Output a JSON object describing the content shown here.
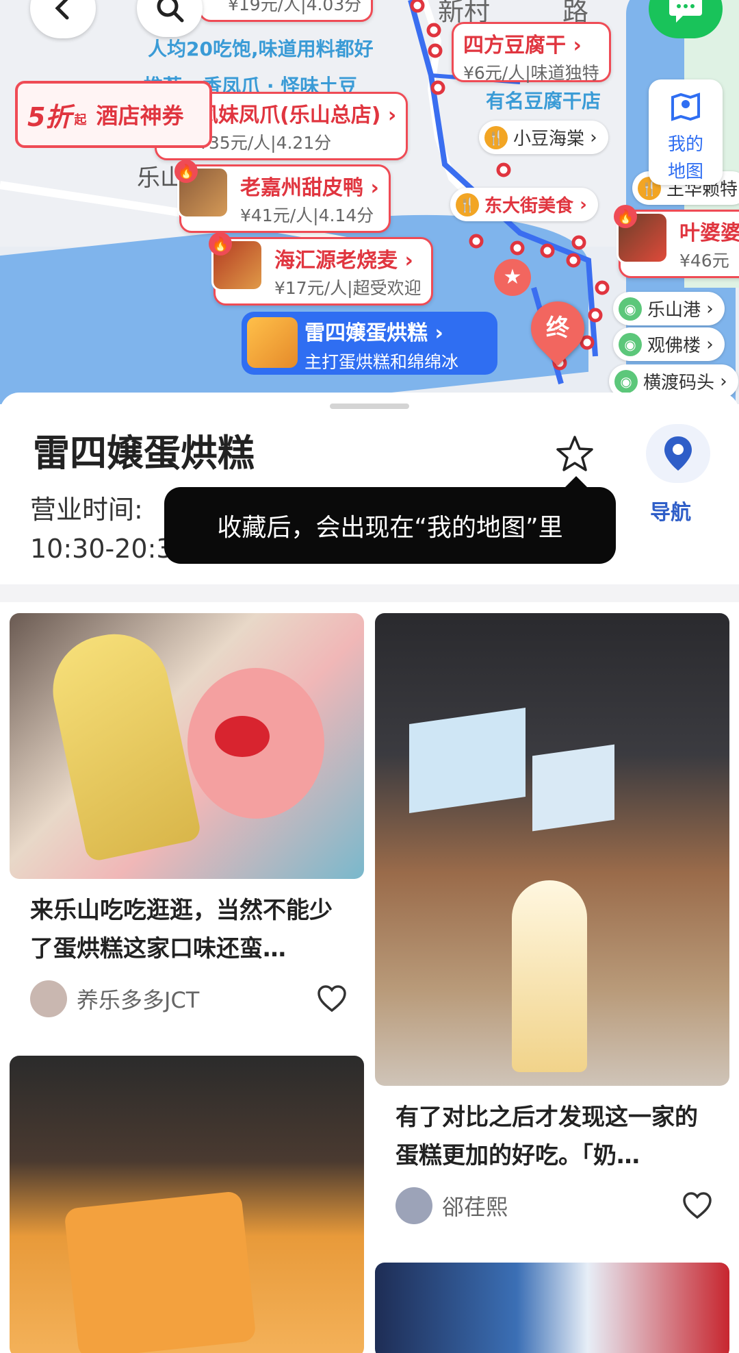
{
  "map": {
    "coupon": {
      "discount": "5折",
      "qi": "起",
      "label": "酒店神券"
    },
    "labels": {
      "area_text": "人均20吃饱,味道用料都好",
      "tags_line": "推荐 · 香凤爪 · 怪味土豆",
      "road1": "新村",
      "road2": "路",
      "known_tofu": "有名豆腐干店",
      "leshan_text": "乐山"
    },
    "pins": [
      {
        "title": "",
        "sub": "¥19元/人|4.03分"
      },
      {
        "title": "四方豆腐干",
        "sub": "¥6元/人|味道独特"
      },
      {
        "title": "凤妹凤爪(乐山总店)",
        "sub": "¥35元/人|4.21分"
      },
      {
        "title": "老嘉州甜皮鸭",
        "sub": "¥41元/人|4.14分"
      },
      {
        "title": "海汇源老烧麦",
        "sub": "¥17元/人|超受欢迎"
      },
      {
        "title": "叶婆婆",
        "sub": "¥46元"
      }
    ],
    "tags": [
      "小豆海棠",
      "东大街美食",
      "乐山港",
      "观佛楼",
      "横渡码头",
      "王华赖特"
    ],
    "selected": {
      "title": "雷四嬢蛋烘糕",
      "sub": "主打蛋烘糕和绵绵冰"
    },
    "end_marker": "终",
    "my_map": "我的地图"
  },
  "sheet": {
    "title": "雷四嬢蛋烘糕",
    "hours_label": "营业时间:",
    "hours_value": "10:30-20:30",
    "tooltip": "收藏后，会出现在“我的地图”里",
    "nav_label": "导航"
  },
  "cards": [
    {
      "caption": "来乐山吃吃逛逛，当然不能少了蛋烘糕这家口味还蛮…",
      "author": "养乐多多JCT"
    },
    {
      "caption": "有了对比之后才发现这一家的蛋糕更加的好吃。「奶…",
      "author": "郤荏熙"
    }
  ],
  "colors": {
    "accent": "#2f6ef2",
    "pin_red": "#ef4b55",
    "tag_green": "#5cc77a",
    "tag_orange": "#f2a524"
  }
}
